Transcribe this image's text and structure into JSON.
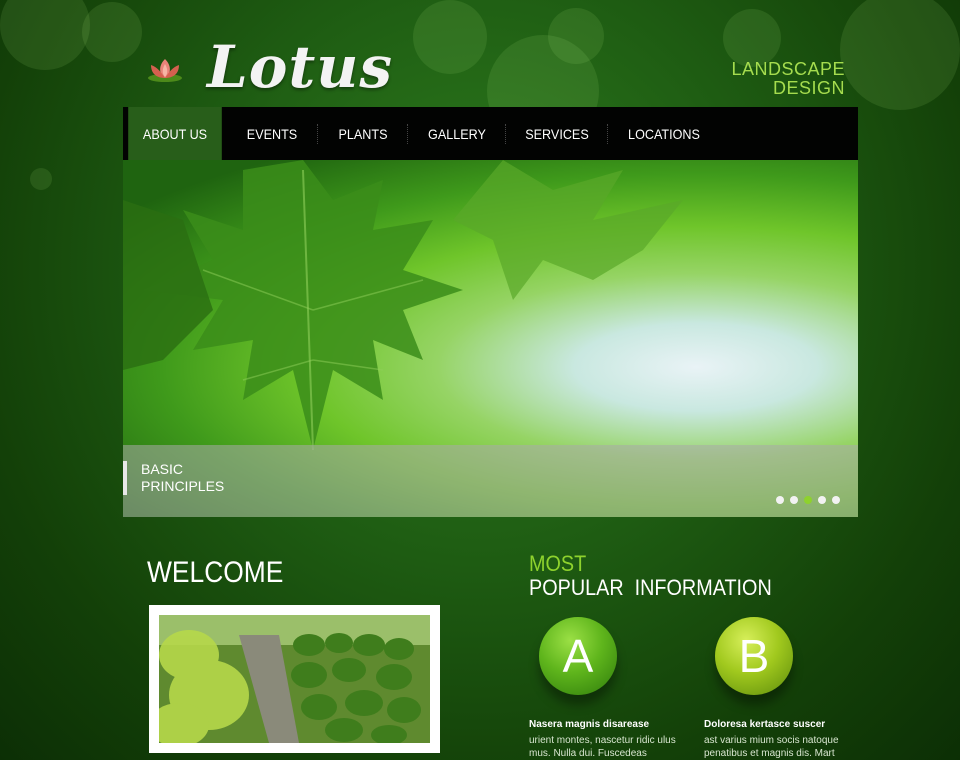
{
  "header": {
    "logo_text": "Lotus",
    "tagline": [
      "LANDSCAPE",
      "DESIGN"
    ]
  },
  "nav": {
    "items": [
      {
        "label": "ABOUT US",
        "active": true
      },
      {
        "label": "EVENTS"
      },
      {
        "label": "PLANTS"
      },
      {
        "label": "GALLERY"
      },
      {
        "label": "SERVICES"
      },
      {
        "label": "LOCATIONS"
      }
    ]
  },
  "slider": {
    "caption": [
      "BASIC",
      "PRINCIPLES"
    ],
    "dots": 5,
    "active_dot": 3
  },
  "welcome": {
    "title": "WELCOME"
  },
  "popular": {
    "title_top": "MOST",
    "title_bottom": "POPULAR  INFORMATION",
    "items": [
      {
        "badge": "A",
        "title": "Nasera magnis disarease",
        "body": "urient montes, nascetur ridic ulus mus. Nulla dui. Fuscedeas"
      },
      {
        "badge": "B",
        "title": "Doloresa kertasce suscer",
        "body": "ast varius mium socis natoque penatibus et magnis dis. Mart"
      }
    ]
  },
  "colors": {
    "accent": "#8ed22d",
    "tagline": "#a5dc4e",
    "nav_bg": "#020302",
    "nav_active": "#285e1a"
  }
}
